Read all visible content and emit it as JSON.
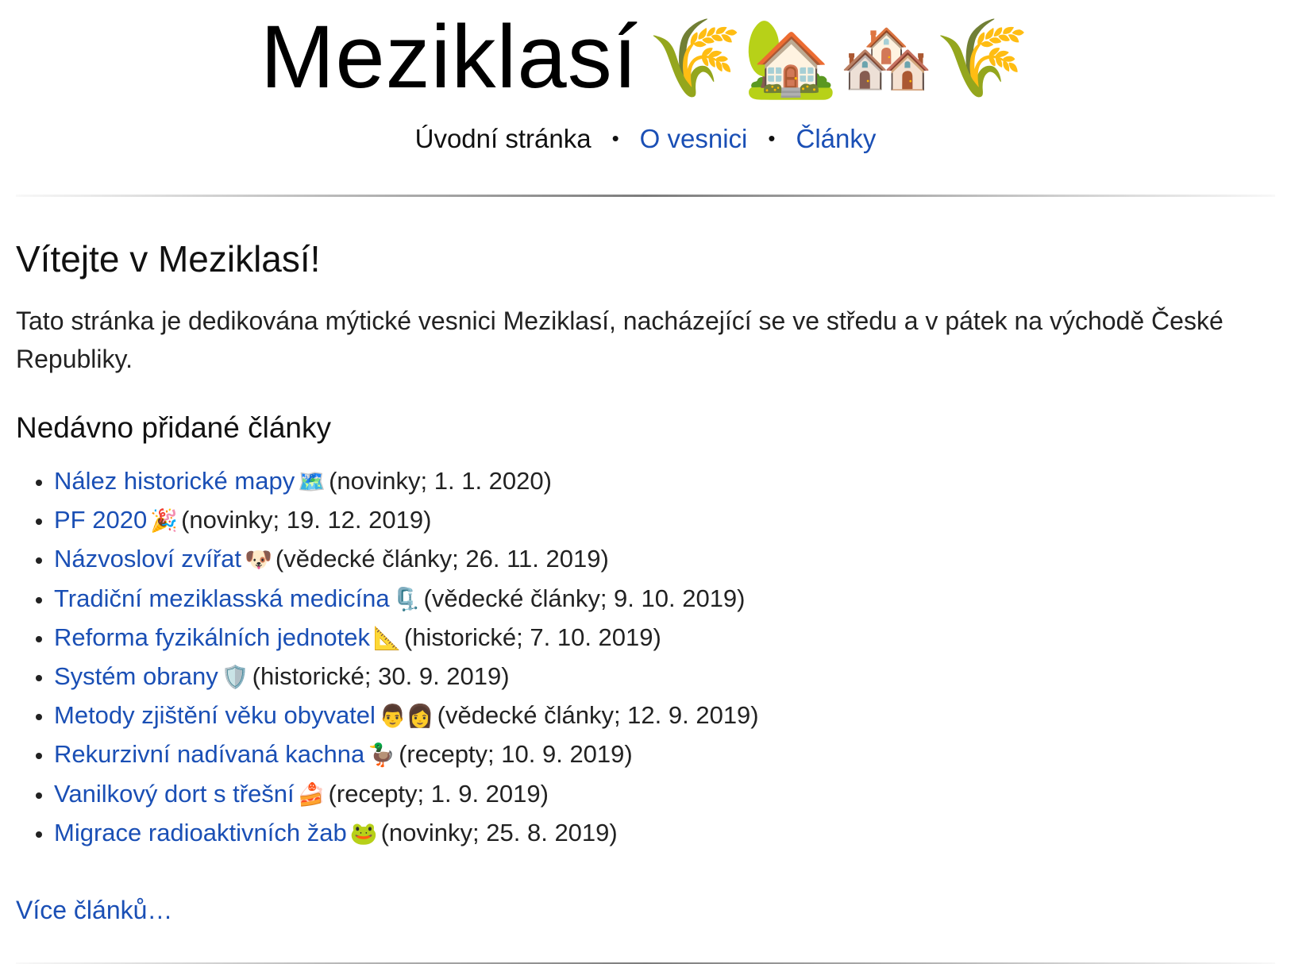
{
  "site": {
    "title": "Meziklasí",
    "title_emoji": "🌾🏡🏘️🌾"
  },
  "nav": {
    "items": [
      {
        "label": "Úvodní stránka",
        "current": true
      },
      {
        "label": "O vesnici",
        "current": false
      },
      {
        "label": "Články",
        "current": false
      }
    ],
    "separator": "•"
  },
  "main": {
    "heading": "Vítejte v Meziklasí!",
    "intro": "Tato stránka je dedikována mýtické vesnici Meziklasí, nacházející se ve středu a v pátek na východě České Republiky.",
    "recent_heading": "Nedávno přidané články",
    "articles": [
      {
        "title": "Nález historické mapy",
        "emoji": "🗺️",
        "meta": "(novinky; 1. 1. 2020)"
      },
      {
        "title": "PF 2020",
        "emoji": "🎉",
        "meta": "(novinky; 19. 12. 2019)"
      },
      {
        "title": "Názvosloví zvířat",
        "emoji": "🐶",
        "meta": "(vědecké články; 26. 11. 2019)"
      },
      {
        "title": "Tradiční meziklasská medicína",
        "emoji": "🗜️",
        "meta": "(vědecké články; 9. 10. 2019)"
      },
      {
        "title": "Reforma fyzikálních jednotek",
        "emoji": "📐",
        "meta": "(historické; 7. 10. 2019)"
      },
      {
        "title": "Systém obrany",
        "emoji": "🛡️",
        "meta": "(historické; 30. 9. 2019)"
      },
      {
        "title": "Metody zjištění věku obyvatel",
        "emoji": "👨👩",
        "meta": "(vědecké články; 12. 9. 2019)"
      },
      {
        "title": "Rekurzivní nadívaná kachna",
        "emoji": "🦆",
        "meta": "(recepty; 10. 9. 2019)"
      },
      {
        "title": "Vanilkový dort s třešní",
        "emoji": "🍰",
        "meta": "(recepty; 1. 9. 2019)"
      },
      {
        "title": "Migrace radioaktivních žab",
        "emoji": "🐸",
        "meta": "(novinky; 25. 8. 2019)"
      }
    ],
    "more_link": "Více článků…"
  },
  "colors": {
    "link": "#1a4fb5",
    "text": "#222222",
    "background": "#ffffff"
  }
}
